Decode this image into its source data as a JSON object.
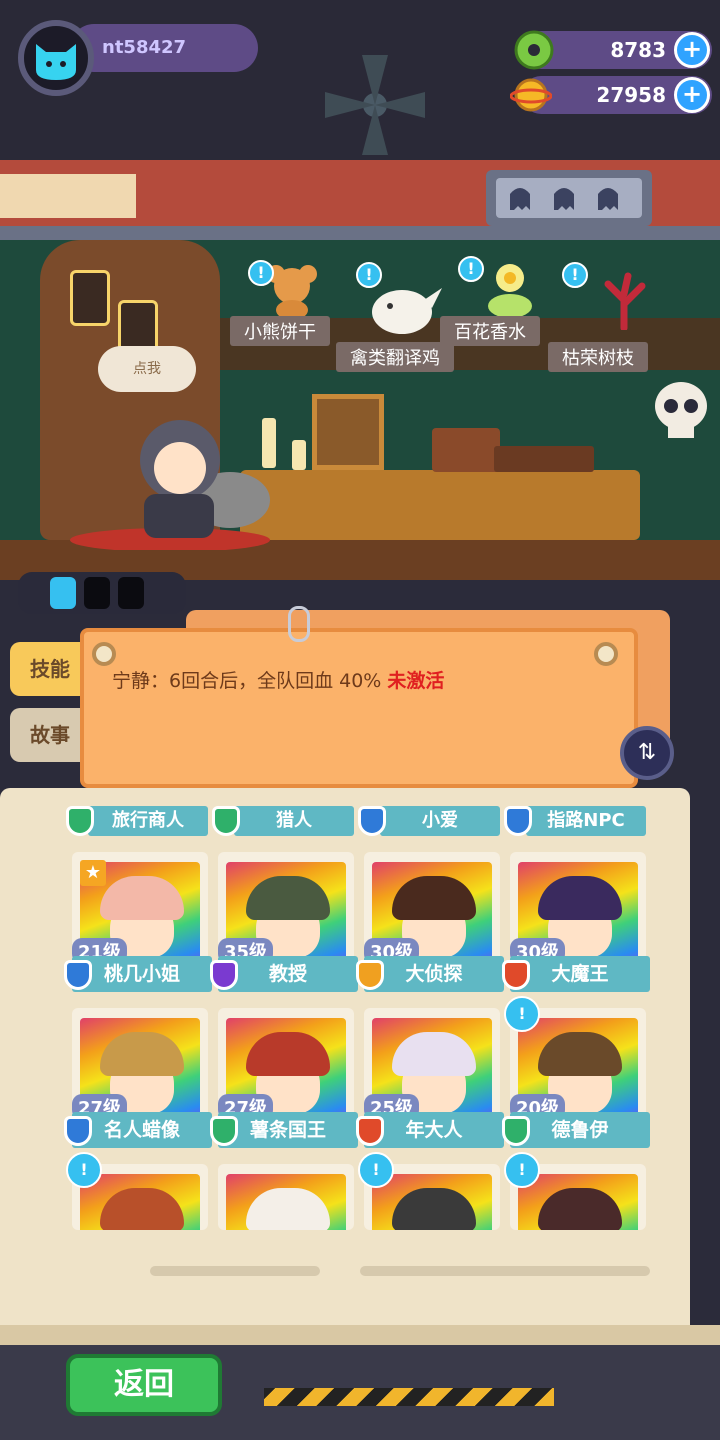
{
  "player": {
    "name": "nt58427"
  },
  "currencies": [
    {
      "icon": "green-donut-icon",
      "value": "8783",
      "color": "#7ac943"
    },
    {
      "icon": "gold-coin-planet-icon",
      "value": "27958",
      "color": "#f6b826"
    }
  ],
  "shop_items": [
    {
      "label": "小熊饼干",
      "icon": "teddy-bear-cookie-icon"
    },
    {
      "label": "禽类翻译鸡",
      "icon": "white-chicken-icon"
    },
    {
      "label": "百花香水",
      "icon": "flower-perfume-icon"
    },
    {
      "label": "枯荣树枝",
      "icon": "red-branch-icon"
    }
  ],
  "npc_speech": "点我",
  "tabs": {
    "skill": "技能",
    "story": "故事"
  },
  "skill": {
    "text": "宁静：6回合后，全队回血 40%",
    "status": "未激活"
  },
  "categories": [
    {
      "label": "旅行商人",
      "color": "#2fb06a"
    },
    {
      "label": "猎人",
      "color": "#2fb06a"
    },
    {
      "label": "小爱",
      "color": "#2f7ad8"
    },
    {
      "label": "指路NPC",
      "color": "#2f7ad8"
    }
  ],
  "characters": [
    {
      "name": "桃几小姐",
      "level": "21级",
      "hair": "#f3b8a8",
      "shield": "#2f7ad8",
      "starred": true,
      "alert": false
    },
    {
      "name": "教授",
      "level": "35级",
      "hair": "#4a5a40",
      "shield": "#7a3ad0",
      "starred": false,
      "alert": false
    },
    {
      "name": "大侦探",
      "level": "30级",
      "hair": "#4a2a1e",
      "shield": "#f0a020",
      "starred": false,
      "alert": false
    },
    {
      "name": "大魔王",
      "level": "30级",
      "hair": "#3a2a5e",
      "shield": "#e04a2a",
      "starred": false,
      "alert": false
    },
    {
      "name": "名人蜡像",
      "level": "27级",
      "hair": "#c89a4a",
      "shield": "#2f7ad8",
      "starred": false,
      "alert": false
    },
    {
      "name": "薯条国王",
      "level": "27级",
      "hair": "#b83a2a",
      "shield": "#2fb06a",
      "starred": false,
      "alert": false
    },
    {
      "name": "年大人",
      "level": "25级",
      "hair": "#e8e0f0",
      "shield": "#e04a2a",
      "starred": false,
      "alert": false
    },
    {
      "name": "德鲁伊",
      "level": "20级",
      "hair": "#6a4a2a",
      "shield": "#2fb06a",
      "starred": false,
      "alert": true
    },
    {
      "name": "",
      "level": "",
      "hair": "#b8502a",
      "shield": "",
      "starred": false,
      "alert": true
    },
    {
      "name": "",
      "level": "",
      "hair": "#f4efe8",
      "shield": "",
      "starred": false,
      "alert": false
    },
    {
      "name": "",
      "level": "",
      "hair": "#3a3a3a",
      "shield": "",
      "starred": false,
      "alert": true
    },
    {
      "name": "",
      "level": "",
      "hair": "#4a2a2a",
      "shield": "",
      "starred": false,
      "alert": true
    }
  ],
  "back_button": "返回"
}
